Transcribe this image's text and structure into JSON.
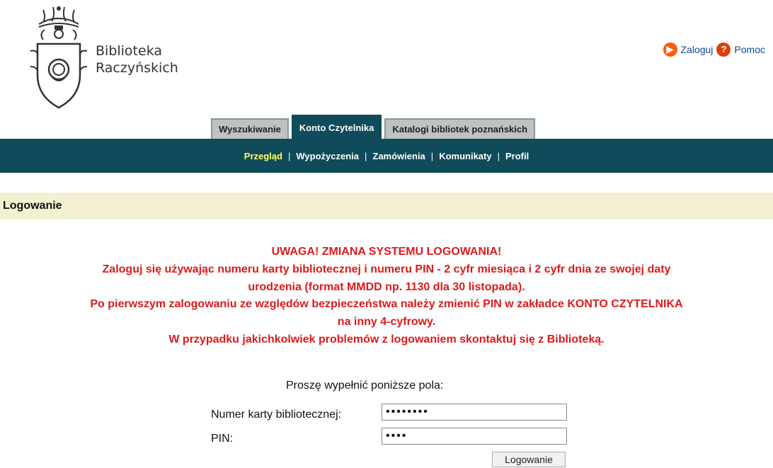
{
  "header": {
    "library_name_line1": "Biblioteka",
    "library_name_line2": "Raczyńskich",
    "login_link": "Zaloguj",
    "help_link": "Pomoc",
    "icons": {
      "login": "play-circle-icon",
      "help": "question-circle-icon"
    }
  },
  "tabs": [
    {
      "label": "Wyszukiwanie",
      "active": false
    },
    {
      "label": "Konto Czytelnika",
      "active": true
    },
    {
      "label": "Katalogi bibliotek poznańskich",
      "active": false
    }
  ],
  "subnav": [
    {
      "label": "Przegląd",
      "active": true
    },
    {
      "label": "Wypożyczenia",
      "active": false
    },
    {
      "label": "Zamówienia",
      "active": false
    },
    {
      "label": "Komunikaty",
      "active": false
    },
    {
      "label": "Profil",
      "active": false
    }
  ],
  "section": {
    "title": "Logowanie"
  },
  "notice": {
    "lines": [
      "UWAGA! ZMIANA SYSTEMU LOGOWANIA!",
      "Zaloguj się używając numeru karty bibliotecznej i numeru PIN - 2 cyfr miesiąca i 2 cyfr dnia ze swojej daty",
      "urodzenia (format MMDD np. 1130 dla 30 listopada).",
      "Po pierwszym zalogowaniu ze względów bezpieczeństwa należy zmienić PIN w zakładce KONTO CZYTELNIKA",
      "na inny 4-cyfrowy.",
      "W przypadku jakichkolwiek problemów z logowaniem skontaktuj się z Biblioteką."
    ]
  },
  "form": {
    "intro": "Proszę wypełnić poniższe pola:",
    "card_label": "Numer karty bibliotecznej:",
    "card_value": "••••••••",
    "pin_label": "PIN:",
    "pin_value": "••••",
    "submit_label": "Logowanie"
  },
  "colors": {
    "nav_bg": "#0f4b5a",
    "active_subnav": "#ffff66",
    "notice_red": "#dd1a1a",
    "section_bg": "#f3f1d2",
    "tab_bg": "#bcc3c2",
    "link_blue": "#0d4b94",
    "icon_orange": "#ff5b0a"
  }
}
